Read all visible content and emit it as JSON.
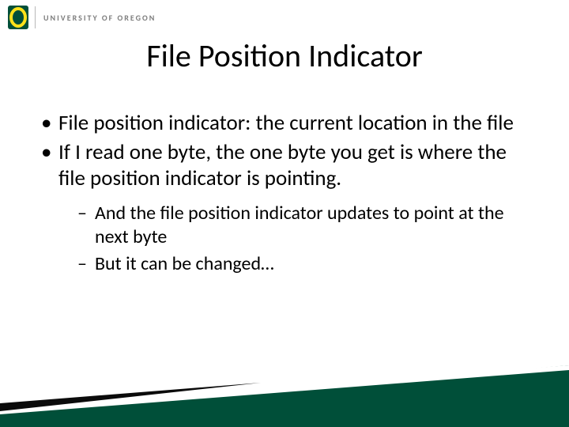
{
  "header": {
    "university_text": "UNIVERSITY OF OREGON",
    "logo_name": "oregon-o-logo"
  },
  "title": "File Position Indicator",
  "bullets": [
    {
      "text": "File position indicator: the current location in the file",
      "sub": []
    },
    {
      "text": "If I read one byte, the one byte you get is where the file position indicator is pointing.",
      "sub": [
        "And the file position indicator updates to point at the next byte",
        "But it can be changed…"
      ]
    }
  ],
  "colors": {
    "brand_green": "#004F39",
    "brand_yellow": "#FEE11A",
    "header_gray": "#7d7d7d"
  }
}
